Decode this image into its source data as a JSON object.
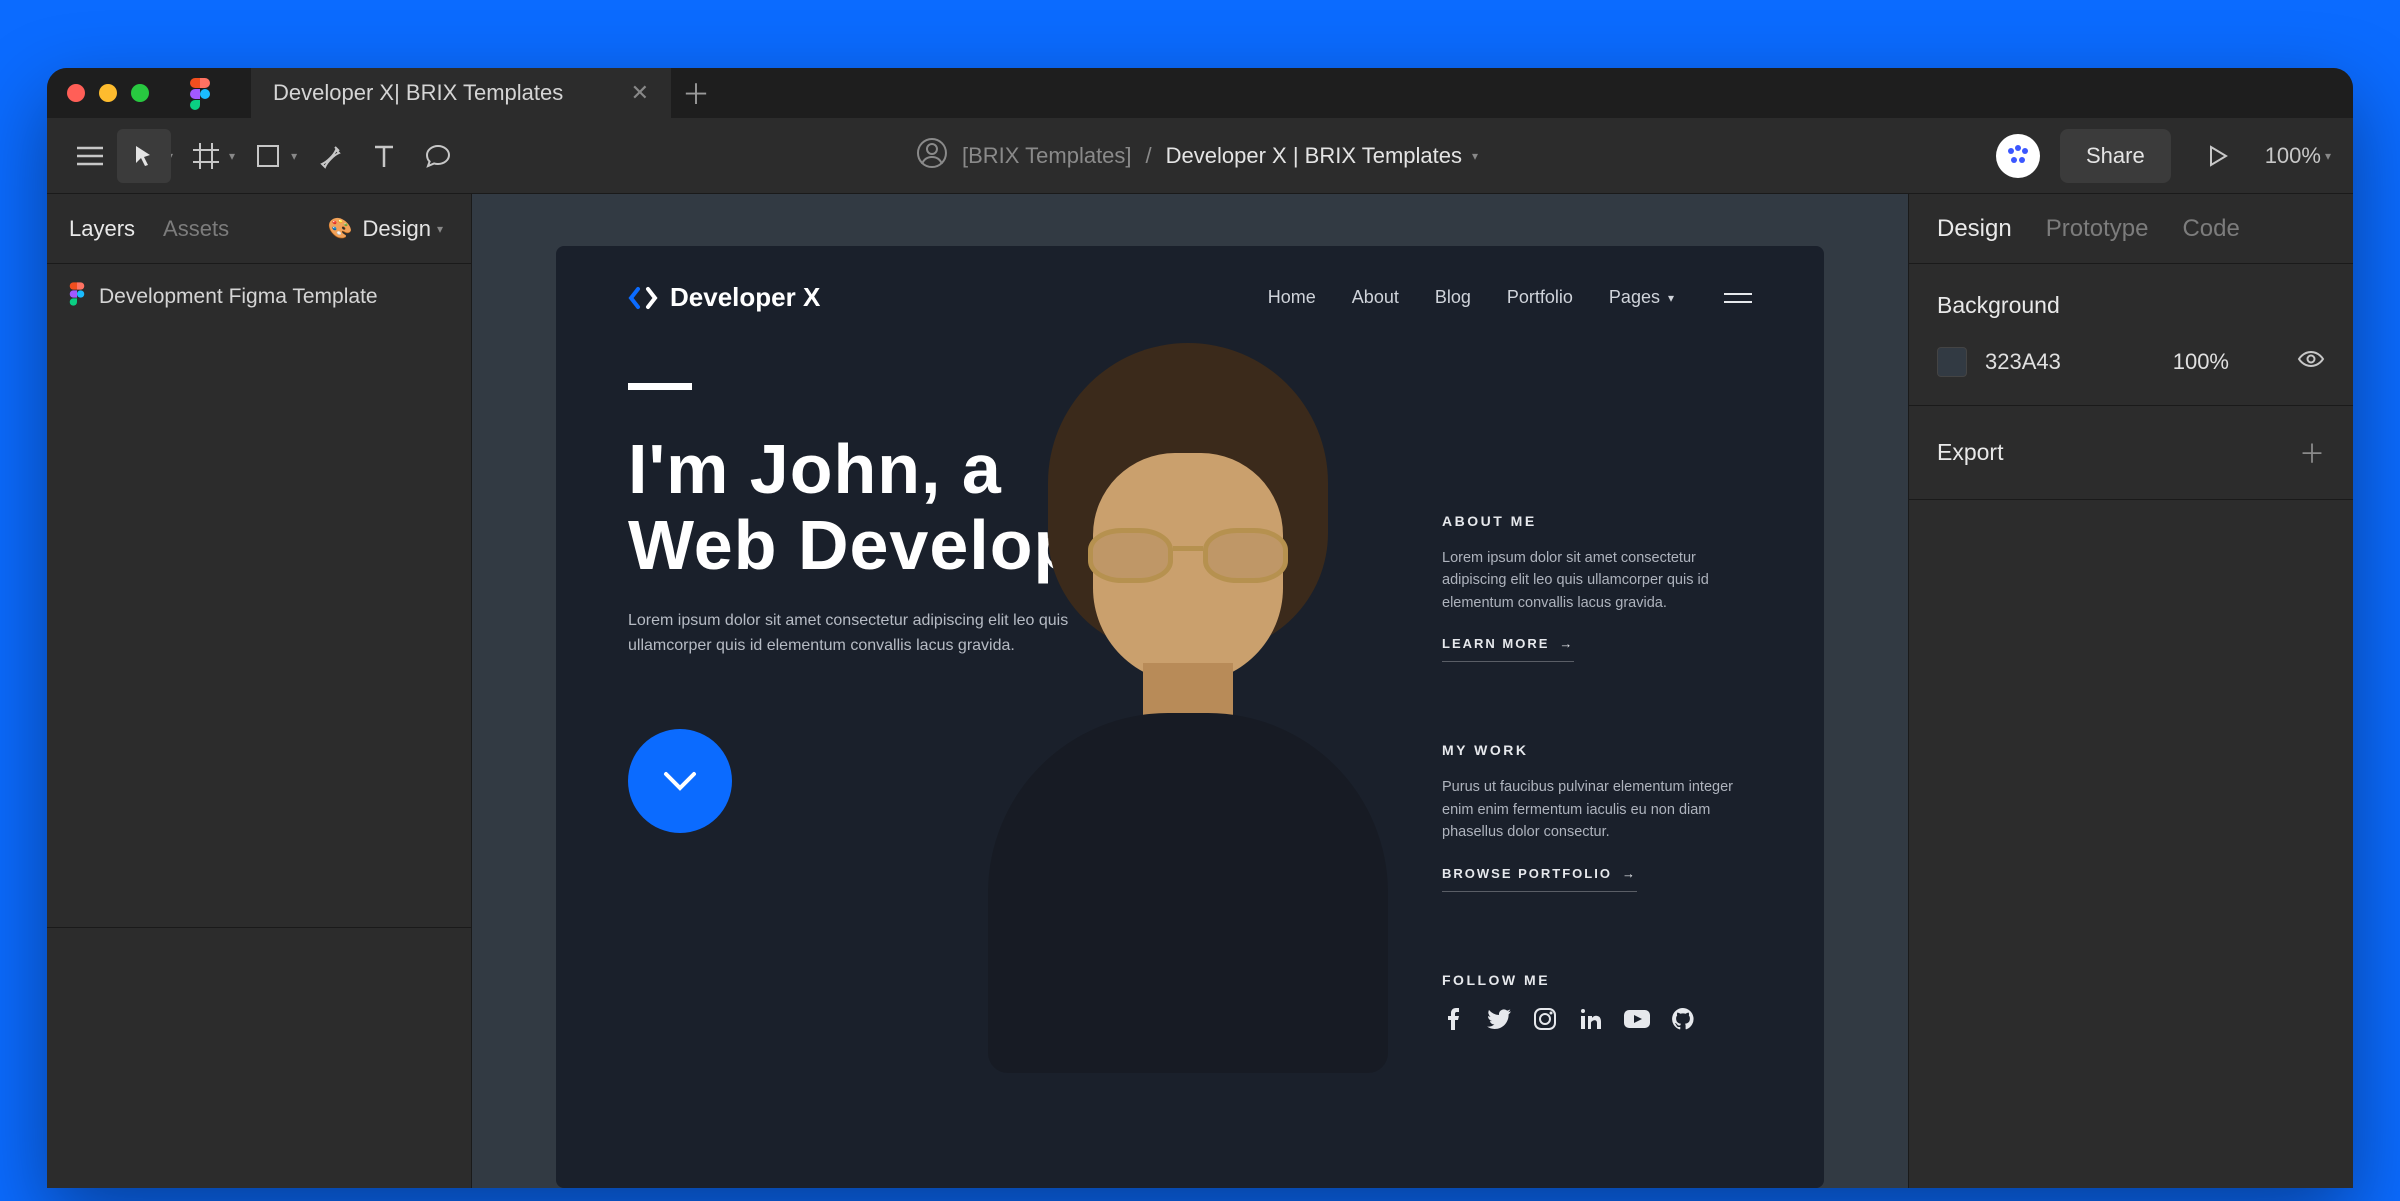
{
  "window": {
    "tab_title": "Developer X| BRIX Templates"
  },
  "toolbar": {
    "owner": "[BRIX Templates]",
    "separator": "/",
    "file": "Developer X | BRIX Templates",
    "share_label": "Share",
    "zoom": "100%"
  },
  "left_panel": {
    "tab_layers": "Layers",
    "tab_assets": "Assets",
    "page_name": "Design",
    "layer_0": "Development Figma Template"
  },
  "right_panel": {
    "tab_design": "Design",
    "tab_prototype": "Prototype",
    "tab_code": "Code",
    "background_label": "Background",
    "background_hex": "323A43",
    "background_opacity": "100%",
    "export_label": "Export"
  },
  "frame": {
    "brand": "Developer X",
    "nav": {
      "home": "Home",
      "about": "About",
      "blog": "Blog",
      "portfolio": "Portfolio",
      "pages": "Pages"
    },
    "hero": {
      "title_line1": "I'm John, a",
      "title_line2": "Web Developer",
      "desc": "Lorem ipsum dolor sit amet consectetur adipiscing elit leo quis ullamcorper quis id elementum convallis lacus gravida."
    },
    "about": {
      "heading": "ABOUT ME",
      "body": "Lorem ipsum dolor sit amet consectetur adipiscing elit leo quis ullamcorper quis id elementum convallis lacus gravida.",
      "cta": "LEARN MORE"
    },
    "work": {
      "heading": "MY WORK",
      "body": "Purus ut faucibus pulvinar elementum integer enim enim fermentum iaculis eu non diam phasellus dolor consectur.",
      "cta": "BROWSE PORTFOLIO"
    },
    "follow": {
      "heading": "FOLLOW ME"
    }
  }
}
